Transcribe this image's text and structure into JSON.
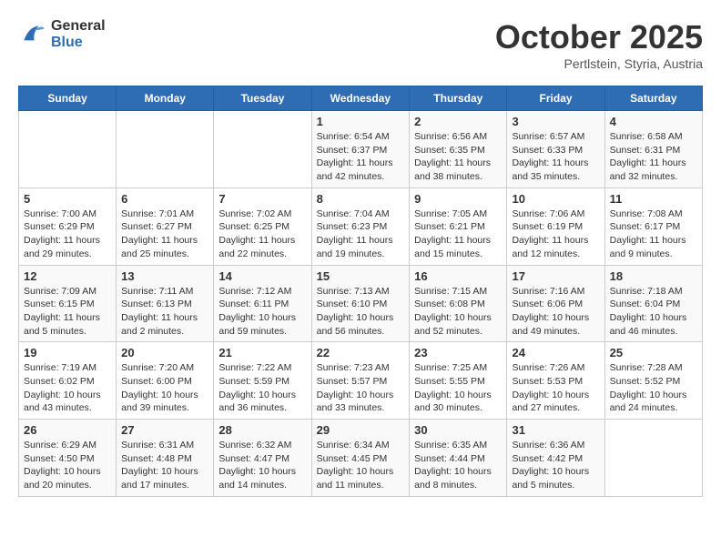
{
  "header": {
    "logo_line1": "General",
    "logo_line2": "Blue",
    "month": "October 2025",
    "location": "Pertlstein, Styria, Austria"
  },
  "weekdays": [
    "Sunday",
    "Monday",
    "Tuesday",
    "Wednesday",
    "Thursday",
    "Friday",
    "Saturday"
  ],
  "weeks": [
    [
      {
        "day": "",
        "sunrise": "",
        "sunset": "",
        "daylight": ""
      },
      {
        "day": "",
        "sunrise": "",
        "sunset": "",
        "daylight": ""
      },
      {
        "day": "",
        "sunrise": "",
        "sunset": "",
        "daylight": ""
      },
      {
        "day": "1",
        "sunrise": "Sunrise: 6:54 AM",
        "sunset": "Sunset: 6:37 PM",
        "daylight": "Daylight: 11 hours and 42 minutes."
      },
      {
        "day": "2",
        "sunrise": "Sunrise: 6:56 AM",
        "sunset": "Sunset: 6:35 PM",
        "daylight": "Daylight: 11 hours and 38 minutes."
      },
      {
        "day": "3",
        "sunrise": "Sunrise: 6:57 AM",
        "sunset": "Sunset: 6:33 PM",
        "daylight": "Daylight: 11 hours and 35 minutes."
      },
      {
        "day": "4",
        "sunrise": "Sunrise: 6:58 AM",
        "sunset": "Sunset: 6:31 PM",
        "daylight": "Daylight: 11 hours and 32 minutes."
      }
    ],
    [
      {
        "day": "5",
        "sunrise": "Sunrise: 7:00 AM",
        "sunset": "Sunset: 6:29 PM",
        "daylight": "Daylight: 11 hours and 29 minutes."
      },
      {
        "day": "6",
        "sunrise": "Sunrise: 7:01 AM",
        "sunset": "Sunset: 6:27 PM",
        "daylight": "Daylight: 11 hours and 25 minutes."
      },
      {
        "day": "7",
        "sunrise": "Sunrise: 7:02 AM",
        "sunset": "Sunset: 6:25 PM",
        "daylight": "Daylight: 11 hours and 22 minutes."
      },
      {
        "day": "8",
        "sunrise": "Sunrise: 7:04 AM",
        "sunset": "Sunset: 6:23 PM",
        "daylight": "Daylight: 11 hours and 19 minutes."
      },
      {
        "day": "9",
        "sunrise": "Sunrise: 7:05 AM",
        "sunset": "Sunset: 6:21 PM",
        "daylight": "Daylight: 11 hours and 15 minutes."
      },
      {
        "day": "10",
        "sunrise": "Sunrise: 7:06 AM",
        "sunset": "Sunset: 6:19 PM",
        "daylight": "Daylight: 11 hours and 12 minutes."
      },
      {
        "day": "11",
        "sunrise": "Sunrise: 7:08 AM",
        "sunset": "Sunset: 6:17 PM",
        "daylight": "Daylight: 11 hours and 9 minutes."
      }
    ],
    [
      {
        "day": "12",
        "sunrise": "Sunrise: 7:09 AM",
        "sunset": "Sunset: 6:15 PM",
        "daylight": "Daylight: 11 hours and 5 minutes."
      },
      {
        "day": "13",
        "sunrise": "Sunrise: 7:11 AM",
        "sunset": "Sunset: 6:13 PM",
        "daylight": "Daylight: 11 hours and 2 minutes."
      },
      {
        "day": "14",
        "sunrise": "Sunrise: 7:12 AM",
        "sunset": "Sunset: 6:11 PM",
        "daylight": "Daylight: 10 hours and 59 minutes."
      },
      {
        "day": "15",
        "sunrise": "Sunrise: 7:13 AM",
        "sunset": "Sunset: 6:10 PM",
        "daylight": "Daylight: 10 hours and 56 minutes."
      },
      {
        "day": "16",
        "sunrise": "Sunrise: 7:15 AM",
        "sunset": "Sunset: 6:08 PM",
        "daylight": "Daylight: 10 hours and 52 minutes."
      },
      {
        "day": "17",
        "sunrise": "Sunrise: 7:16 AM",
        "sunset": "Sunset: 6:06 PM",
        "daylight": "Daylight: 10 hours and 49 minutes."
      },
      {
        "day": "18",
        "sunrise": "Sunrise: 7:18 AM",
        "sunset": "Sunset: 6:04 PM",
        "daylight": "Daylight: 10 hours and 46 minutes."
      }
    ],
    [
      {
        "day": "19",
        "sunrise": "Sunrise: 7:19 AM",
        "sunset": "Sunset: 6:02 PM",
        "daylight": "Daylight: 10 hours and 43 minutes."
      },
      {
        "day": "20",
        "sunrise": "Sunrise: 7:20 AM",
        "sunset": "Sunset: 6:00 PM",
        "daylight": "Daylight: 10 hours and 39 minutes."
      },
      {
        "day": "21",
        "sunrise": "Sunrise: 7:22 AM",
        "sunset": "Sunset: 5:59 PM",
        "daylight": "Daylight: 10 hours and 36 minutes."
      },
      {
        "day": "22",
        "sunrise": "Sunrise: 7:23 AM",
        "sunset": "Sunset: 5:57 PM",
        "daylight": "Daylight: 10 hours and 33 minutes."
      },
      {
        "day": "23",
        "sunrise": "Sunrise: 7:25 AM",
        "sunset": "Sunset: 5:55 PM",
        "daylight": "Daylight: 10 hours and 30 minutes."
      },
      {
        "day": "24",
        "sunrise": "Sunrise: 7:26 AM",
        "sunset": "Sunset: 5:53 PM",
        "daylight": "Daylight: 10 hours and 27 minutes."
      },
      {
        "day": "25",
        "sunrise": "Sunrise: 7:28 AM",
        "sunset": "Sunset: 5:52 PM",
        "daylight": "Daylight: 10 hours and 24 minutes."
      }
    ],
    [
      {
        "day": "26",
        "sunrise": "Sunrise: 6:29 AM",
        "sunset": "Sunset: 4:50 PM",
        "daylight": "Daylight: 10 hours and 20 minutes."
      },
      {
        "day": "27",
        "sunrise": "Sunrise: 6:31 AM",
        "sunset": "Sunset: 4:48 PM",
        "daylight": "Daylight: 10 hours and 17 minutes."
      },
      {
        "day": "28",
        "sunrise": "Sunrise: 6:32 AM",
        "sunset": "Sunset: 4:47 PM",
        "daylight": "Daylight: 10 hours and 14 minutes."
      },
      {
        "day": "29",
        "sunrise": "Sunrise: 6:34 AM",
        "sunset": "Sunset: 4:45 PM",
        "daylight": "Daylight: 10 hours and 11 minutes."
      },
      {
        "day": "30",
        "sunrise": "Sunrise: 6:35 AM",
        "sunset": "Sunset: 4:44 PM",
        "daylight": "Daylight: 10 hours and 8 minutes."
      },
      {
        "day": "31",
        "sunrise": "Sunrise: 6:36 AM",
        "sunset": "Sunset: 4:42 PM",
        "daylight": "Daylight: 10 hours and 5 minutes."
      },
      {
        "day": "",
        "sunrise": "",
        "sunset": "",
        "daylight": ""
      }
    ]
  ]
}
